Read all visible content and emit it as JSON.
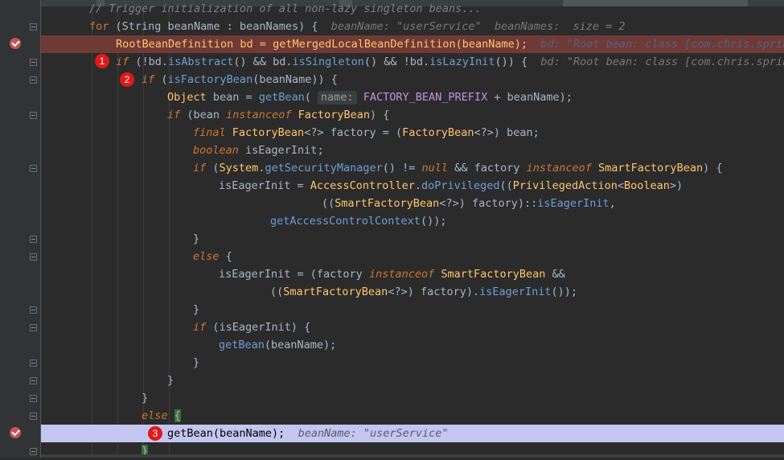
{
  "editor": {
    "comment": "// Trigger initialization of all non-lazy singleton beans...",
    "l_for_kw": "for",
    "l_for_rest": " (String beanName : beanNames) {",
    "l_for_hint": "beanName: \"userService\"  beanNames:  size = 2",
    "l_rbd": "RootBeanDefinition bd = getMergedLocalBeanDefinition(beanName);",
    "l_rbd_hint": "bd: \"Root bean: class [com.chris.spring",
    "l_if1_hint": "bd: \"Root bean: class [com.chris.spring",
    "param_name": "name:",
    "const_prefix": "FACTORY_BEAN_PREFIX",
    "last_hint": "beanName: \"userService\"",
    "markers": [
      "1",
      "2",
      "3"
    ]
  }
}
